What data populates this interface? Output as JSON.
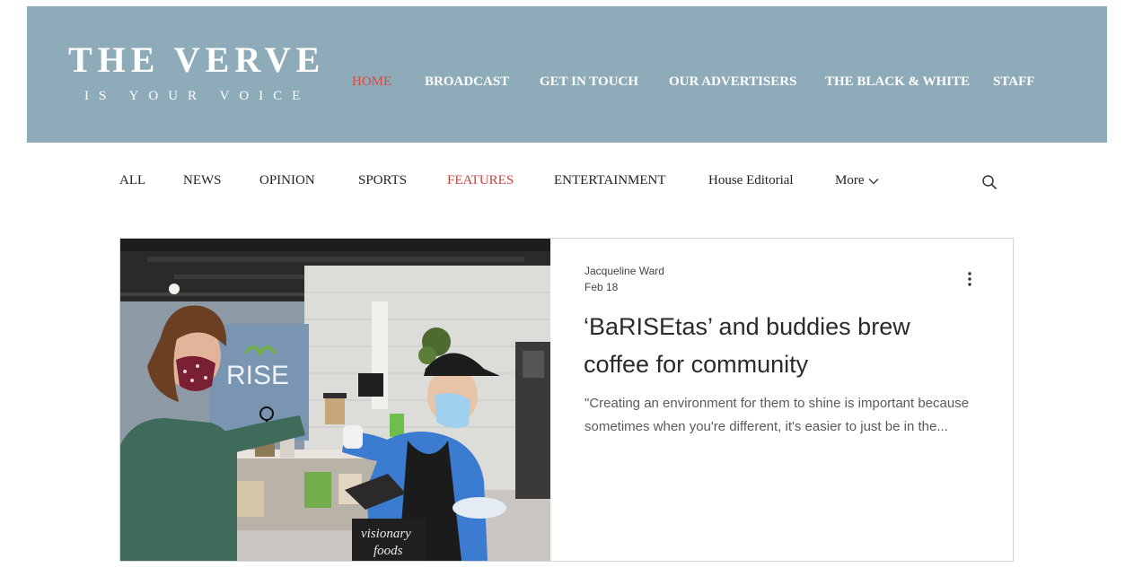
{
  "brand": {
    "title": "THE VERVE",
    "tagline": "IS YOUR VOICE",
    "header_color": "#8eabba"
  },
  "main_nav": [
    {
      "label": "HOME",
      "active": true
    },
    {
      "label": "BROADCAST"
    },
    {
      "label": "GET IN TOUCH"
    },
    {
      "label": "OUR ADVERTISERS"
    },
    {
      "label": "THE BLACK & WHITE"
    },
    {
      "label": "STAFF"
    }
  ],
  "category_nav": [
    {
      "label": "ALL"
    },
    {
      "label": "NEWS"
    },
    {
      "label": "OPINION"
    },
    {
      "label": "SPORTS"
    },
    {
      "label": "FEATURES",
      "active": true
    },
    {
      "label": "ENTERTAINMENT"
    },
    {
      "label": "House Editorial"
    },
    {
      "label": "More"
    }
  ],
  "icons": {
    "search": "search-icon",
    "more_options": "kebab-menu-icon",
    "dropdown": "chevron-down-icon"
  },
  "post": {
    "author": "Jacqueline Ward",
    "date": "Feb 18",
    "title": "‘BaRISEtas’ and buddies brew coffee for community",
    "excerpt": "\"Creating an environment for them to shine is important because sometimes when you're different, it's easier to just be in the...",
    "image_sign_text": "RISE",
    "image_box_text_1": "visionary",
    "image_box_text_2": "foods"
  },
  "colors": {
    "active_main": "#e0463b",
    "active_category": "#c9433f"
  }
}
